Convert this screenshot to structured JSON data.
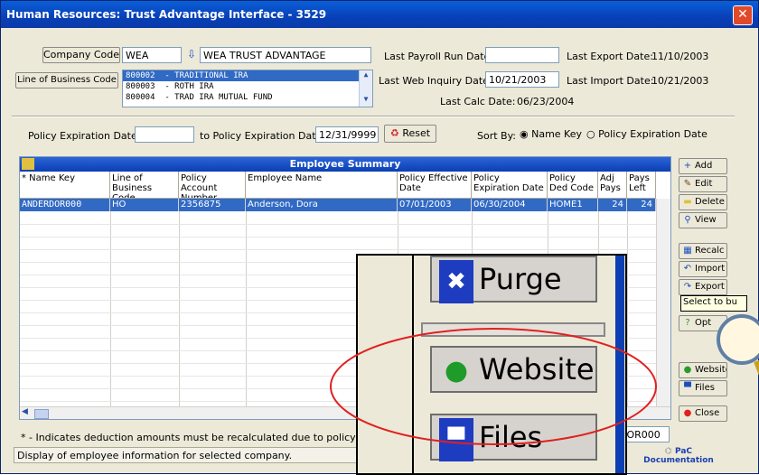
{
  "window": {
    "title": "Human Resources: Trust Advantage Interface - 3529",
    "close_glyph": "✕"
  },
  "company": {
    "label": "Company Code",
    "code": "WEA",
    "name": "WEA TRUST ADVANTAGE"
  },
  "lob": {
    "label": "Line of Business Code",
    "items": [
      {
        "code": "800002",
        "desc": "- TRADITIONAL IRA",
        "selected": true
      },
      {
        "code": "800003",
        "desc": "- ROTH IRA",
        "selected": false
      },
      {
        "code": "800004",
        "desc": "- TRAD IRA MUTUAL FUND",
        "selected": false
      }
    ]
  },
  "dates": {
    "last_payroll_label": "Last Payroll Run Date:",
    "last_payroll": "",
    "last_web_label": "Last Web Inquiry Date:",
    "last_web": "10/21/2003",
    "last_calc_label": "Last Calc Date:",
    "last_calc": "06/23/2004",
    "last_export_label": "Last Export Date:",
    "last_export": "11/10/2003",
    "last_import_label": "Last Import Date:",
    "last_import": "10/21/2003"
  },
  "filter": {
    "exp_label": "Policy Expiration Date:",
    "exp_value": "",
    "to_label": "to Policy Expiration Date:",
    "to_value": "12/31/9999",
    "reset_label": "Reset",
    "sort_label": "Sort By:",
    "sort_name": "Name Key",
    "sort_exp": "Policy Expiration Date",
    "sort_selected": "Name Key"
  },
  "grid": {
    "title": "Employee Summary",
    "headers": [
      "* Name Key",
      "Line of Business Code",
      "Policy Account Number",
      "Employee Name",
      "Policy Effective Date",
      "Policy Expiration Date",
      "Policy Ded Code",
      "Adj Pays",
      "Pays Left"
    ],
    "rows": [
      [
        "ANDERDOR000",
        "HO",
        "2356875",
        "Anderson, Dora",
        "07/01/2003",
        "06/30/2004",
        "HOME1",
        "24",
        "24"
      ]
    ]
  },
  "side_buttons": [
    {
      "label": "Add",
      "icon": "plus-icon"
    },
    {
      "label": "Edit",
      "icon": "pencil-icon"
    },
    {
      "label": "Delete",
      "icon": "eraser-icon"
    },
    {
      "label": "View",
      "icon": "magnifier-icon"
    },
    {
      "label": "Recalc",
      "icon": "calculator-icon"
    },
    {
      "label": "Import",
      "icon": "import-arrow-icon"
    },
    {
      "label": "Export",
      "icon": "export-arrow-icon"
    },
    {
      "label": "Opt",
      "icon": "question-icon"
    },
    {
      "label": "Website",
      "icon": "globe-icon"
    },
    {
      "label": "Files",
      "icon": "floppy-icon"
    },
    {
      "label": "Close",
      "icon": "red-dot-icon"
    }
  ],
  "tooltip": "Select to bu",
  "footer": {
    "note": "* - Indicates deduction amounts must be recalculated due to policy changes",
    "status": "Display of employee information for selected company.",
    "selected_key": "DOR000",
    "doc_label": "PaC Documentation"
  },
  "zoom": {
    "purge": "Purge",
    "website": "Website",
    "files": "Files"
  },
  "colors": {
    "title_bar": "#0a4fd0",
    "selection": "#316ac5",
    "callout": "#e02020"
  }
}
